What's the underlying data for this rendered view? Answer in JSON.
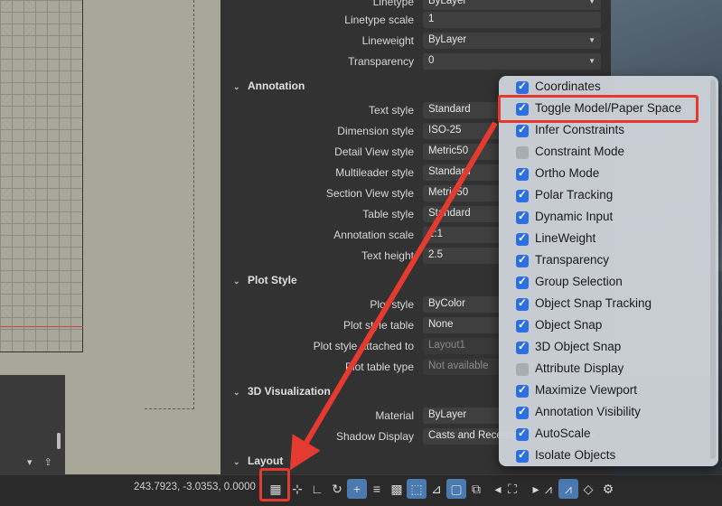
{
  "properties": {
    "general_rows": [
      {
        "label": "Linetype",
        "value": "ByLayer",
        "dropdown": true
      },
      {
        "label": "Linetype scale",
        "value": "1",
        "dropdown": false
      },
      {
        "label": "Lineweight",
        "value": "ByLayer",
        "dropdown": true
      },
      {
        "label": "Transparency",
        "value": "0",
        "dropdown": true
      }
    ],
    "annotation": {
      "title": "Annotation",
      "rows": [
        {
          "label": "Text style",
          "value": "Standard"
        },
        {
          "label": "Dimension style",
          "value": "ISO-25"
        },
        {
          "label": "Detail View style",
          "value": "Metric50"
        },
        {
          "label": "Multileader style",
          "value": "Standard"
        },
        {
          "label": "Section View style",
          "value": "Metric50"
        },
        {
          "label": "Table style",
          "value": "Standard"
        },
        {
          "label": "Annotation scale",
          "value": "1:1"
        },
        {
          "label": "Text height",
          "value": "2.5"
        }
      ]
    },
    "plot_style": {
      "title": "Plot Style",
      "rows": [
        {
          "label": "Plot style",
          "value": "ByColor",
          "dim": false
        },
        {
          "label": "Plot style table",
          "value": "None",
          "dim": false
        },
        {
          "label": "Plot style attached to",
          "value": "Layout1",
          "dim": true
        },
        {
          "label": "Plot table type",
          "value": "Not available",
          "dim": true
        }
      ]
    },
    "visualization": {
      "title": "3D Visualization",
      "rows": [
        {
          "label": "Material",
          "value": "ByLayer"
        },
        {
          "label": "Shadow Display",
          "value": "Casts and Receives"
        }
      ]
    },
    "layout": {
      "title": "Layout"
    }
  },
  "statusbar": {
    "coordinates": "243.7923, -3.0353, 0.0000"
  },
  "menu": {
    "items": [
      {
        "label": "Coordinates",
        "checked": true
      },
      {
        "label": "Toggle Model/Paper Space",
        "checked": true
      },
      {
        "label": "Infer Constraints",
        "checked": true
      },
      {
        "label": "Constraint Mode",
        "checked": false
      },
      {
        "label": "Ortho Mode",
        "checked": true
      },
      {
        "label": "Polar Tracking",
        "checked": true
      },
      {
        "label": "Dynamic Input",
        "checked": true
      },
      {
        "label": "LineWeight",
        "checked": true
      },
      {
        "label": "Transparency",
        "checked": true
      },
      {
        "label": "Group Selection",
        "checked": true
      },
      {
        "label": "Object Snap Tracking",
        "checked": true
      },
      {
        "label": "Object Snap",
        "checked": true
      },
      {
        "label": "3D Object Snap",
        "checked": true
      },
      {
        "label": "Attribute Display",
        "checked": false
      },
      {
        "label": "Maximize Viewport",
        "checked": true
      },
      {
        "label": "Annotation Visibility",
        "checked": true
      },
      {
        "label": "AutoScale",
        "checked": true
      },
      {
        "label": "Isolate Objects",
        "checked": true
      }
    ]
  },
  "colors": {
    "highlight": "#e53a2f",
    "checkbox": "#2d6fe0"
  }
}
